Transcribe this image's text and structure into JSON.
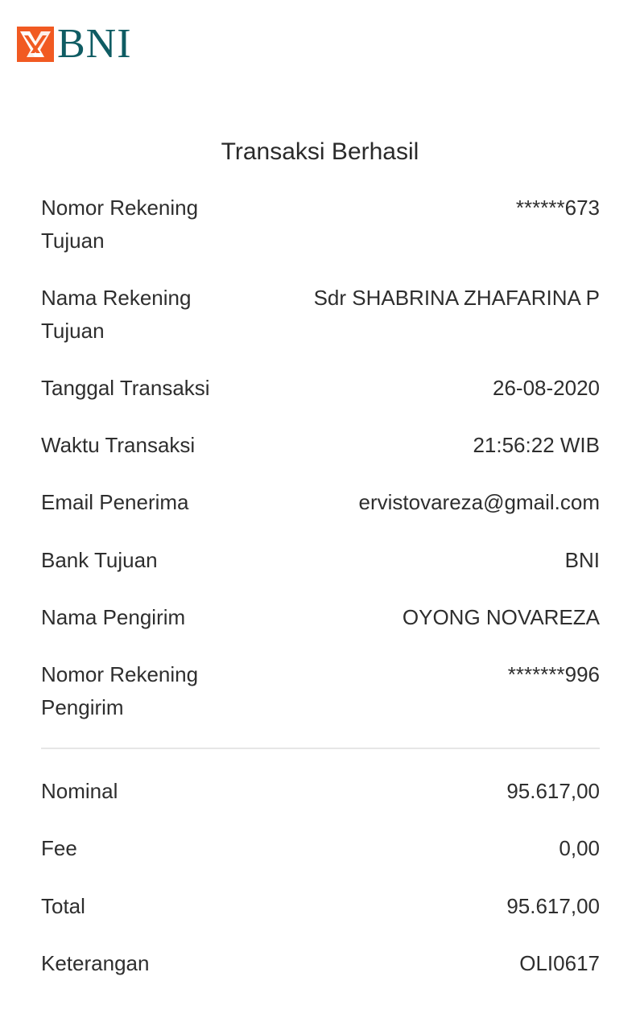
{
  "brand": {
    "name": "BNI",
    "colors": {
      "orange": "#f15a22",
      "teal": "#0f5c63"
    }
  },
  "title": "Transaksi Berhasil",
  "details": [
    {
      "label": "Nomor Rekening Tujuan",
      "value": "******673"
    },
    {
      "label": "Nama Rekening Tujuan",
      "value": "Sdr SHABRINA ZHAFARINA P"
    },
    {
      "label": "Tanggal Transaksi",
      "value": "26-08-2020"
    },
    {
      "label": "Waktu Transaksi",
      "value": "21:56:22 WIB"
    },
    {
      "label": "Email Penerima",
      "value": "ervistovareza@gmail.com"
    },
    {
      "label": "Bank Tujuan",
      "value": "BNI"
    },
    {
      "label": "Nama Pengirim",
      "value": "OYONG NOVAREZA"
    },
    {
      "label": "Nomor Rekening Pengirim",
      "value": "*******996"
    }
  ],
  "summary": [
    {
      "label": "Nominal",
      "value": "95.617,00"
    },
    {
      "label": "Fee",
      "value": "0,00"
    },
    {
      "label": "Total",
      "value": "95.617,00"
    },
    {
      "label": "Keterangan",
      "value": "OLI0617"
    }
  ]
}
